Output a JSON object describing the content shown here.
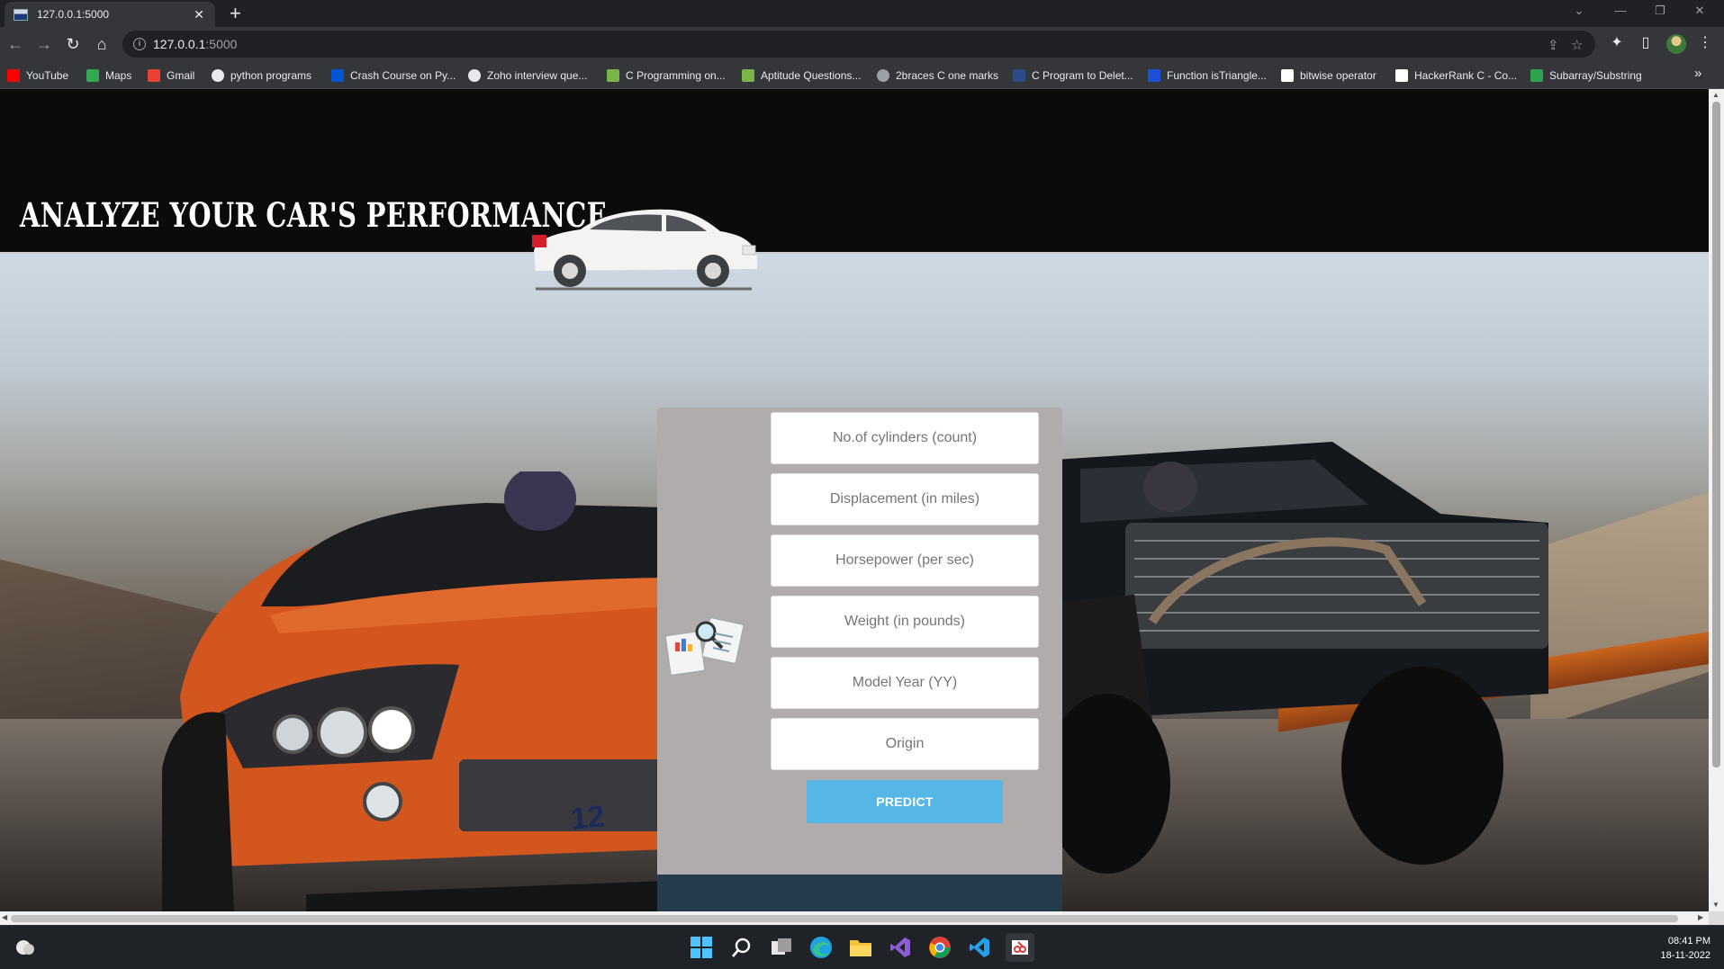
{
  "browser": {
    "tab_title": "127.0.0.1:5000",
    "tab_close": "✕",
    "new_tab": "+",
    "url_host": "127.0.0.1",
    "url_port": ":5000",
    "bookmarks": [
      {
        "label": "YouTube",
        "icon": "youtube-icon",
        "color": "#ff0000"
      },
      {
        "label": "Maps",
        "icon": "maps-icon",
        "color": "#34a853"
      },
      {
        "label": "Gmail",
        "icon": "gmail-icon",
        "color": "#ea4335"
      },
      {
        "label": "python programs",
        "icon": "github-icon",
        "color": "#e8eaed"
      },
      {
        "label": "Crash Course on Py...",
        "icon": "coursera-icon",
        "color": "#0056d2"
      },
      {
        "label": "Zoho interview que...",
        "icon": "github-icon",
        "color": "#e8eaed"
      },
      {
        "label": "C Programming on...",
        "icon": "leaf-icon",
        "color": "#7ab648"
      },
      {
        "label": "Aptitude Questions...",
        "icon": "leaf-icon",
        "color": "#7ab648"
      },
      {
        "label": "2braces C one marks",
        "icon": "globe-icon",
        "color": "#9aa0a6"
      },
      {
        "label": "C Program to Delet...",
        "icon": "blue-square-icon",
        "color": "#2b4a8a"
      },
      {
        "label": "Function isTriangle...",
        "icon": "letter-l-icon",
        "color": "#1e4fd8"
      },
      {
        "label": "bitwise operator",
        "icon": "page-icon",
        "color": "#ffffff"
      },
      {
        "label": "HackerRank C - Co...",
        "icon": "page-icon",
        "color": "#ffffff"
      },
      {
        "label": "Subarray/Substring",
        "icon": "infinity-icon",
        "color": "#2ea44f"
      }
    ],
    "more_bookmarks": "»"
  },
  "page": {
    "title": "ANALYZE YOUR CAR'S PERFORMANCE",
    "form": {
      "fields": [
        {
          "placeholder": "No.of cylinders (count)"
        },
        {
          "placeholder": "Displacement (in miles)"
        },
        {
          "placeholder": "Horsepower (per sec)"
        },
        {
          "placeholder": "Weight (in pounds)"
        },
        {
          "placeholder": "Model Year (YY)"
        },
        {
          "placeholder": "Origin"
        }
      ],
      "submit_label": "PREDICT"
    },
    "colors": {
      "header_bg": "#0b0b0c",
      "form_bg": "#b0acab",
      "form_footer": "#243b4b",
      "button": "#56b7e6"
    }
  },
  "taskbar": {
    "apps": [
      "start-icon",
      "search-icon",
      "task-view-icon",
      "edge-icon",
      "file-explorer-icon",
      "visual-studio-icon",
      "chrome-icon",
      "vscode-icon",
      "snipping-tool-icon"
    ],
    "time": "08:41 PM",
    "date": "18-11-2022"
  }
}
